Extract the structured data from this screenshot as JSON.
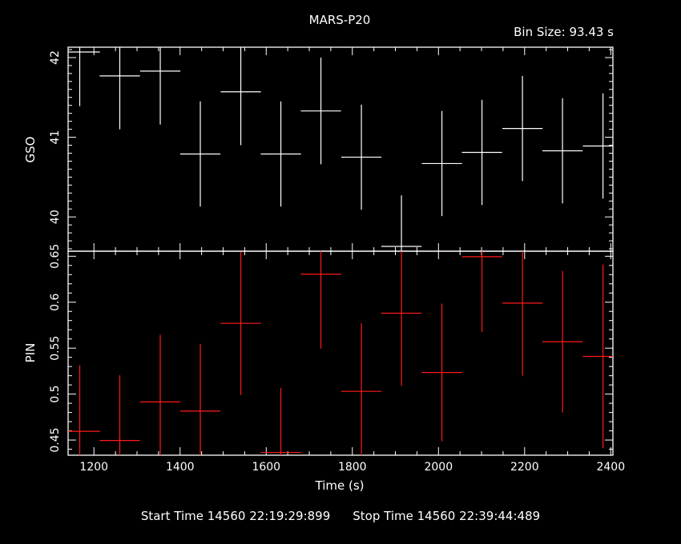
{
  "header": {
    "title": "MARS-P20",
    "bin_size": "Bin Size: 93.43 s"
  },
  "footer": {
    "start_time": "Start Time 14560 22:19:29:899",
    "stop_time": "Stop Time 14560 22:39:44:489"
  },
  "chart_data": [
    {
      "type": "scatter",
      "name_axis": "GSO",
      "ylabel": "GSO",
      "xlabel": "",
      "color": "#ffffff",
      "xlim": [
        1140,
        2405
      ],
      "ylim": [
        39.57,
        42.13
      ],
      "yticks": [
        40,
        41,
        42
      ],
      "half_width": 46.7,
      "points": [
        {
          "x": 1167,
          "y": 42.07,
          "err": 0.68
        },
        {
          "x": 1260,
          "y": 41.77,
          "err": 0.67
        },
        {
          "x": 1354,
          "y": 41.83,
          "err": 0.67
        },
        {
          "x": 1447,
          "y": 40.79,
          "err": 0.66
        },
        {
          "x": 1541,
          "y": 41.57,
          "err": 0.67
        },
        {
          "x": 1634,
          "y": 40.79,
          "err": 0.66
        },
        {
          "x": 1727,
          "y": 41.33,
          "err": 0.67
        },
        {
          "x": 1821,
          "y": 40.75,
          "err": 0.66
        },
        {
          "x": 1914,
          "y": 39.63,
          "err": 0.64
        },
        {
          "x": 2008,
          "y": 40.67,
          "err": 0.66
        },
        {
          "x": 2101,
          "y": 40.81,
          "err": 0.66
        },
        {
          "x": 2195,
          "y": 41.11,
          "err": 0.66
        },
        {
          "x": 2288,
          "y": 40.83,
          "err": 0.66
        },
        {
          "x": 2382,
          "y": 40.89,
          "err": 0.66
        }
      ]
    },
    {
      "type": "scatter",
      "name_axis": "PIN",
      "ylabel": "PIN",
      "xlabel": "Time (s)",
      "color": "#ff1a1a",
      "xlim": [
        1140,
        2405
      ],
      "ylim": [
        0.4335,
        0.6555
      ],
      "yticks": [
        0.45,
        0.5,
        0.55,
        0.6,
        0.65
      ],
      "ytick_labels": [
        "0.45",
        "0.5",
        "0.55",
        "0.6",
        "0.65"
      ],
      "xticks": [
        1200,
        1400,
        1600,
        1800,
        2000,
        2200,
        2400
      ],
      "half_width": 46.7,
      "points": [
        {
          "x": 1167,
          "y": 0.4595,
          "err": 0.072
        },
        {
          "x": 1260,
          "y": 0.4495,
          "err": 0.071
        },
        {
          "x": 1354,
          "y": 0.4915,
          "err": 0.073
        },
        {
          "x": 1447,
          "y": 0.4815,
          "err": 0.073
        },
        {
          "x": 1541,
          "y": 0.577,
          "err": 0.078
        },
        {
          "x": 1634,
          "y": 0.4365,
          "err": 0.07
        },
        {
          "x": 1727,
          "y": 0.6305,
          "err": 0.081
        },
        {
          "x": 1821,
          "y": 0.503,
          "err": 0.074
        },
        {
          "x": 1914,
          "y": 0.588,
          "err": 0.079
        },
        {
          "x": 2008,
          "y": 0.5235,
          "err": 0.075
        },
        {
          "x": 2101,
          "y": 0.6495,
          "err": 0.082
        },
        {
          "x": 2195,
          "y": 0.599,
          "err": 0.079
        },
        {
          "x": 2288,
          "y": 0.557,
          "err": 0.077
        },
        {
          "x": 2382,
          "y": 0.541,
          "err": 0.1
        }
      ]
    }
  ]
}
